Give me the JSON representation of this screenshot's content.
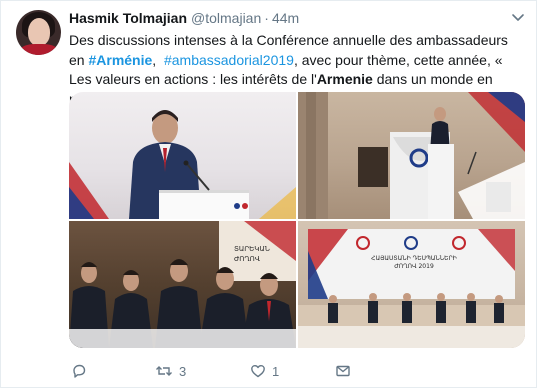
{
  "tweet": {
    "author_name": "Hasmik Tolmajian",
    "author_handle": "@tolmajian",
    "separator": "·",
    "time": "44m",
    "text": {
      "line1_pre": "Des discussions intenses à la Conférence annuelle des ambassadeurs en",
      "tag_armenie": "#Arménie",
      "comma": ",  ",
      "tag_ambassadorial": "#ambassadorial2019",
      "line2_post": ", avec pour thème, cette année, « Les valeurs en actions : les intérêts de l'",
      "bold_armenie": "Armenie",
      "line3_post": " dans un monde en mutation. »"
    }
  },
  "media": {
    "photos": [
      {
        "label": "speaker-at-podium"
      },
      {
        "label": "conference-hall-speaker"
      },
      {
        "label": "panel-seated-closeup"
      },
      {
        "label": "panel-stage-wide"
      }
    ],
    "stage_sign_line1": "ՀԱՅԱՍՏԱՆԻ ԴԵՍՊԱՆՆԵՐԻ",
    "stage_sign_line2": "ԺՈՂՈՎ 2019"
  },
  "actions": {
    "reply_count": "",
    "retweet_count": "3",
    "like_count": "1"
  },
  "colors": {
    "link": "#1b95e0",
    "muted": "#657786",
    "text": "#14171a",
    "red_accent": "#c1272d",
    "blue_accent": "#1f3c88"
  }
}
